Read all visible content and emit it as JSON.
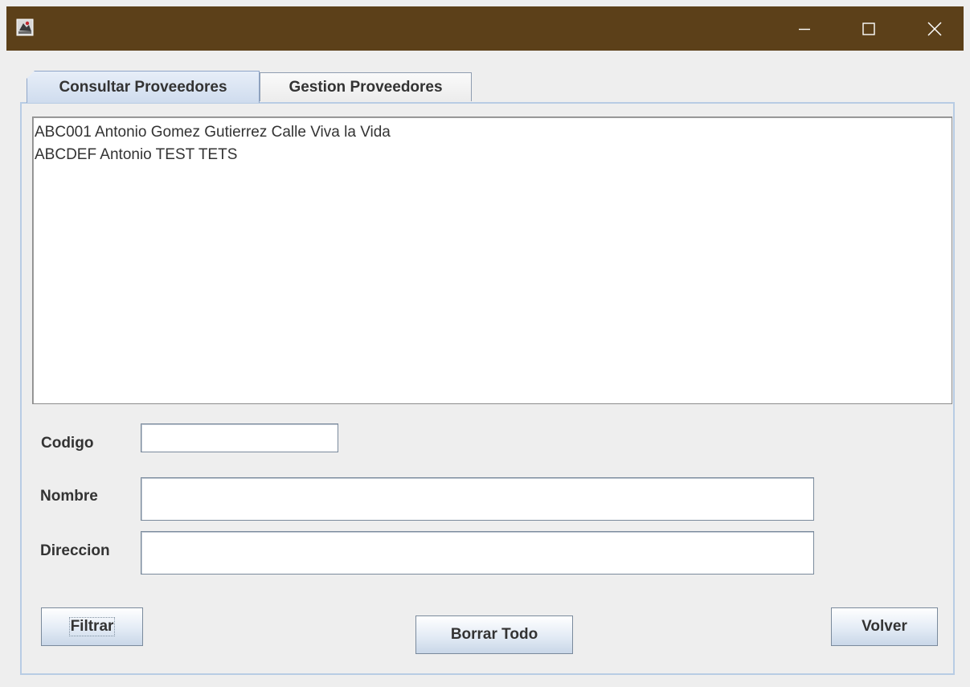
{
  "window": {
    "title_bar_color": "#5c4019",
    "icons": {
      "app": "java-app-icon",
      "minimize": "minimize-icon",
      "maximize": "maximize-icon",
      "close": "close-icon"
    }
  },
  "tabs": [
    {
      "label": "Consultar Proveedores",
      "selected": true
    },
    {
      "label": "Gestion Proveedores",
      "selected": false
    }
  ],
  "results": {
    "items": [
      "ABC001 Antonio Gomez Gutierrez Calle Viva la Vida",
      "ABCDEF Antonio TEST TETS"
    ]
  },
  "form": {
    "codigo": {
      "label": "Codigo",
      "value": ""
    },
    "nombre": {
      "label": "Nombre",
      "value": ""
    },
    "direccion": {
      "label": "Direccion",
      "value": ""
    }
  },
  "buttons": {
    "filtrar": "Filtrar",
    "borrar_todo": "Borrar Todo",
    "volver": "Volver"
  },
  "colors": {
    "selected_tab": "#cfdcee",
    "panel_border": "#b8cce4"
  }
}
